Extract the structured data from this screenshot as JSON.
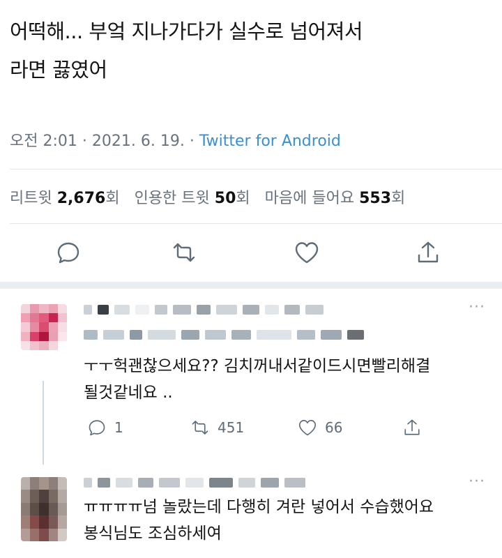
{
  "tweet": {
    "text_line1": "어떡해... 부엌 지나가다가 실수로 넘어져서",
    "text_line2": "라면 끓였어",
    "time": "오전 2:01",
    "date": "2021. 6. 19.",
    "source": "Twitter for Android",
    "stats": {
      "retweet_label": "리트윗",
      "retweet_count": "2,676",
      "retweet_unit": "회",
      "quote_label": "인용한 트윗",
      "quote_count": "50",
      "quote_unit": "회",
      "like_label": "마음에 들어요",
      "like_count": "553",
      "like_unit": "회"
    },
    "actions": [
      "reply-icon",
      "retweet-icon",
      "heart-icon",
      "share-icon"
    ]
  },
  "replies": [
    {
      "text_line1": "ㅜㅜ헉괜찮으세요?? 김치꺼내서같이드시면빨리해결",
      "text_line2": "될것같네요 ..",
      "reply_count": "1",
      "retweet_count": "451",
      "like_count": "66",
      "more": "···"
    },
    {
      "text_line1": "ㅠㅠㅠㅠ넘 놀랐는데 다행히 겨란 넣어서 수습했어요",
      "text_line2": "봉식님도 조심하세여",
      "more": "···"
    }
  ],
  "colors": {
    "meta_gray": "#68737d",
    "link_blue": "#3b8fd1",
    "icon_gray": "#5e6c78"
  }
}
